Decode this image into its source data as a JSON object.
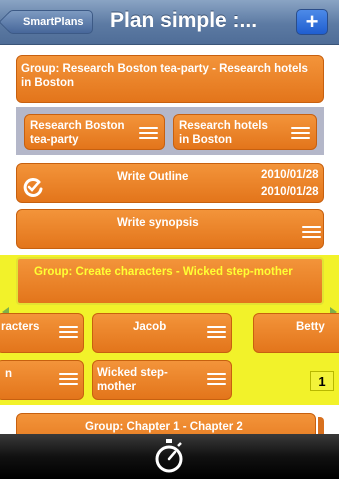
{
  "navbar": {
    "back_label": "SmartPlans",
    "title": "Plan simple :...",
    "add_label": "+"
  },
  "cards": {
    "group_research": "Group: Research Boston tea-party  - Research hotels in Boston",
    "research_boston": "Research Boston tea-party",
    "research_hotels": "Research hotels in Boston",
    "write_outline": "Write Outline",
    "write_outline_date1": "2010/01/28",
    "write_outline_date2": "2010/01/28",
    "write_synopsis": "Write synopsis",
    "group_characters": "Group: Create characters - Wicked step-mother",
    "characters_partial": "racters",
    "jacob": "Jacob",
    "betty_partial": "Betty",
    "n_partial": "n",
    "wicked_stepmother": "Wicked step-mother",
    "group_chapter": "Group: Chapter 1 - Chapter 2"
  },
  "badge": "1",
  "tabbar": {
    "timer_icon": "stopwatch-icon"
  },
  "colors": {
    "nav_blue": "#5c7aa3",
    "card_orange": "#e3751b",
    "highlight_yellow": "#f2f22a",
    "group_text_yellow": "#ffff33"
  }
}
